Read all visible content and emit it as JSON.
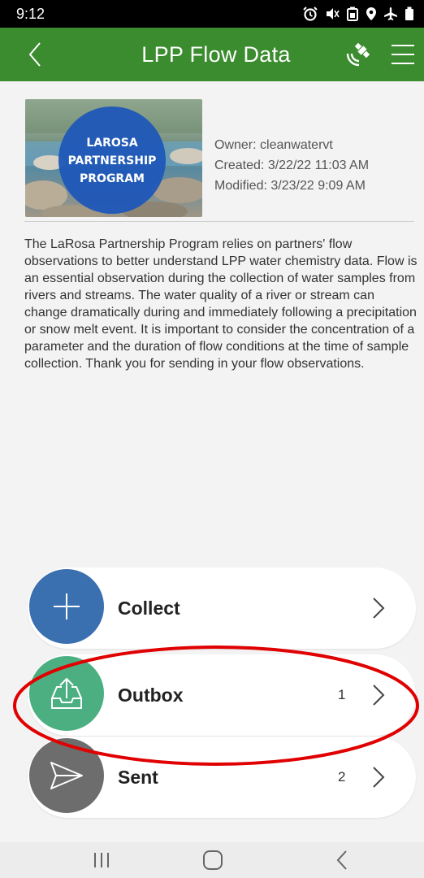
{
  "status_bar": {
    "time": "9:12",
    "icons": [
      "alarm-icon",
      "mute-icon",
      "battery-saver-icon",
      "location-icon",
      "airplane-icon",
      "battery-icon"
    ]
  },
  "app_bar": {
    "title": "LPP Flow Data",
    "color": "#3b8c2f"
  },
  "survey": {
    "thumbnail_text": [
      "LAROSA",
      "PARTNERSHIP",
      "PROGRAM"
    ],
    "owner": "Owner: cleanwatervt",
    "created": "Created: 3/22/22 11:03 AM",
    "modified": "Modified: 3/23/22 9:09 AM",
    "description": "The LaRosa Partnership Program relies on partners' flow observations to better understand LPP water chemistry data. Flow is an essential observation during the collection of water samples from rivers and streams. The water quality of a river or stream can change dramatically during and immediately following a precipitation or snow melt event. It is important to consider the concentration of a parameter and the duration of flow conditions at the time of sample collection. Thank you for sending in your flow observations."
  },
  "actions": {
    "collect": {
      "label": "Collect",
      "count": "",
      "color": "#3a6fb0"
    },
    "outbox": {
      "label": "Outbox",
      "count": "1",
      "color": "#4caf82"
    },
    "sent": {
      "label": "Sent",
      "count": "2",
      "color": "#6d6d6d"
    }
  },
  "highlight_color": "#e00000"
}
